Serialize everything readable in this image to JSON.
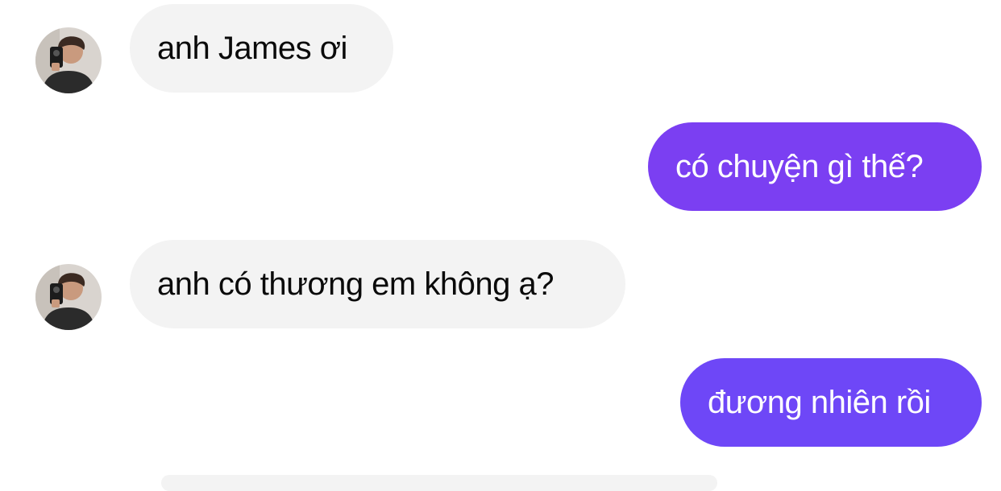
{
  "messages": [
    {
      "direction": "incoming",
      "text": "anh James ơi",
      "avatar_icon": "user-avatar"
    },
    {
      "direction": "outgoing",
      "text": "có chuyện gì thế?"
    },
    {
      "direction": "incoming",
      "text": "anh có thương em không ạ?",
      "avatar_icon": "user-avatar"
    },
    {
      "direction": "outgoing",
      "text": "đương nhiên rồi"
    }
  ],
  "colors": {
    "incoming_bubble": "#f3f3f3",
    "incoming_text": "#0a0a0a",
    "outgoing_bubble_1": "#7b3ff2",
    "outgoing_bubble_2": "#6e47f7",
    "outgoing_text": "#ffffff",
    "background": "#ffffff"
  }
}
